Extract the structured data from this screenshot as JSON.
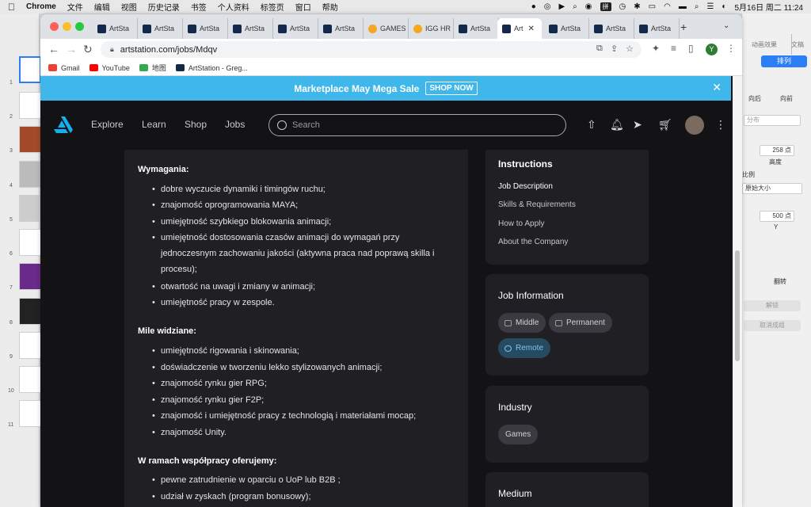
{
  "menubar": {
    "app": "Chrome",
    "items": [
      "文件",
      "编辑",
      "视图",
      "历史记录",
      "书签",
      "个人资料",
      "标签页",
      "窗口",
      "帮助"
    ],
    "input_method": "拼",
    "datetime": "5月16日 周二 11:24"
  },
  "keynote": {
    "slide_numbers": [
      "1",
      "2",
      "3",
      "4",
      "5",
      "6",
      "7",
      "8",
      "9",
      "10",
      "11"
    ],
    "tabs": [
      "动画效果",
      "文稿"
    ],
    "arrange": "排列",
    "back": "向后",
    "front": "向前",
    "distribute": "分布",
    "height_value": "258 点",
    "height_label": "高度",
    "scale_label": "比例",
    "original_size": "原始大小",
    "y_value": "500 点",
    "y_label": "Y",
    "flip_label": "翻转",
    "unlock": "解锁",
    "ungroup": "取消成组"
  },
  "browser": {
    "tabs": [
      {
        "label": "ArtSta",
        "icon": "artstation-icon"
      },
      {
        "label": "ArtSta",
        "icon": "artstation-icon"
      },
      {
        "label": "ArtSta",
        "icon": "artstation-icon"
      },
      {
        "label": "ArtSta",
        "icon": "artstation-icon"
      },
      {
        "label": "ArtSta",
        "icon": "artstation-icon"
      },
      {
        "label": "ArtSta",
        "icon": "artstation-icon"
      },
      {
        "label": "GAMES",
        "icon": "games-icon"
      },
      {
        "label": "IGG HR",
        "icon": "games-icon"
      },
      {
        "label": "ArtSta",
        "icon": "artstation-icon"
      },
      {
        "label": "Art",
        "icon": "artstation-icon",
        "active": true
      },
      {
        "label": "ArtSta",
        "icon": "artstation-icon"
      },
      {
        "label": "ArtSta",
        "icon": "artstation-icon"
      },
      {
        "label": "ArtSta",
        "icon": "artstation-icon"
      }
    ],
    "url": "artstation.com/jobs/Mdqv",
    "profile_initial": "Y",
    "bookmarks": [
      "Gmail",
      "YouTube",
      "地图",
      "ArtStation - Greg..."
    ]
  },
  "page": {
    "promo": {
      "text": "Marketplace May Mega Sale",
      "button": "SHOP NOW"
    },
    "nav": {
      "links": [
        "Explore",
        "Learn",
        "Shop",
        "Jobs"
      ],
      "search_placeholder": "Search"
    },
    "sections": [
      {
        "title": "Wymagania:",
        "items": [
          "dobre wyczucie dynamiki i timingów ruchu;",
          "znajomość oprogramowania MAYA;",
          "umiejętność szybkiego blokowania animacji;",
          "umiejętność dostosowania czasów animacji do wymagań przy jednoczesnym zachowaniu jakości (aktywna praca nad poprawą skilla i procesu);",
          "otwartość na uwagi i zmiany w animacji;",
          "umiejętność pracy w zespole."
        ]
      },
      {
        "title": "Mile widziane:",
        "items": [
          "umiejętność rigowania i skinowania;",
          "doświadczenie w tworzeniu lekko stylizowanych animacji;",
          "znajomość rynku gier RPG;",
          "znajomość rynku gier F2P;",
          "znajomość i umiejętność pracy z technologią i materiałami mocap;",
          "znajomość Unity."
        ]
      },
      {
        "title": "W ramach współpracy oferujemy:",
        "items": [
          "pewne zatrudnienie w oparciu o UoP lub B2B ;",
          "udział w zyskach (program bonusowy);"
        ]
      }
    ],
    "instructions": {
      "title": "Instructions",
      "links": [
        "Job Description",
        "Skills & Requirements",
        "How to Apply",
        "About the Company"
      ]
    },
    "job_info": {
      "title": "Job Information",
      "level": "Middle",
      "type": "Permanent",
      "remote": "Remote"
    },
    "industry": {
      "title": "Industry",
      "value": "Games"
    },
    "medium": {
      "title": "Medium"
    }
  }
}
